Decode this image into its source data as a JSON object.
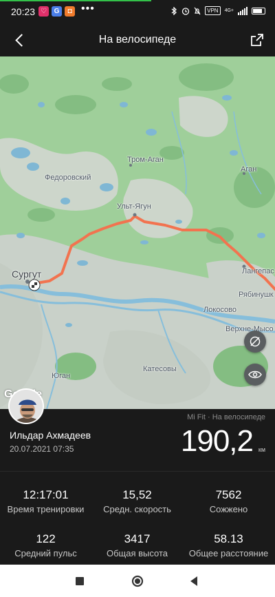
{
  "status_bar": {
    "time": "20:23",
    "apps": [
      {
        "name": "app-heart-icon",
        "glyph": "♡",
        "color": "#e0306a"
      },
      {
        "name": "google-icon",
        "glyph": "G",
        "color": "#4a7ee8"
      },
      {
        "name": "shop-icon",
        "glyph": "◘",
        "color": "#f07b2c"
      }
    ],
    "more": "•••",
    "vpn": "VPN",
    "network": "4G+",
    "battery_icon": "battery-icon"
  },
  "header": {
    "title": "На велосипеде",
    "back_icon": "chevron-left-icon",
    "share_icon": "share-icon"
  },
  "map": {
    "labels": {
      "fedorovsky": "Федоровский",
      "trom_agan": "Тром-Аган",
      "agan": "Аган",
      "ult_yagun": "Ульт-Ягун",
      "surgut": "Сургут",
      "langepas": "Лангепас",
      "ryabinushka": "Рябинушк",
      "lokosovo": "Локосово",
      "verkhne_mysovaya": "Верхне-Мысо",
      "yugan": "Юган",
      "katesovy": "Катесовы"
    },
    "google_logo": "Google",
    "route_color": "#f2734f",
    "buttons": [
      "layers-off-icon",
      "eye-icon"
    ]
  },
  "user": {
    "name": "Ильдар Ахмадеев",
    "date": "20.07.2021 07:35",
    "source": "Mi Fit · На велосипеде",
    "distance": "190,2",
    "unit": "км"
  },
  "stats": [
    {
      "value": "12:17:01",
      "label": "Время тренировки"
    },
    {
      "value": "15,52",
      "label": "Средн. скорость"
    },
    {
      "value": "7562",
      "label": "Сожжено"
    },
    {
      "value": "122",
      "label": "Средний пульс"
    },
    {
      "value": "3417",
      "label": "Общая высота"
    },
    {
      "value": "58.13",
      "label": "Общее расстояние"
    }
  ],
  "nav": {
    "items": [
      "recent-apps-icon",
      "home-icon",
      "back-icon"
    ]
  }
}
